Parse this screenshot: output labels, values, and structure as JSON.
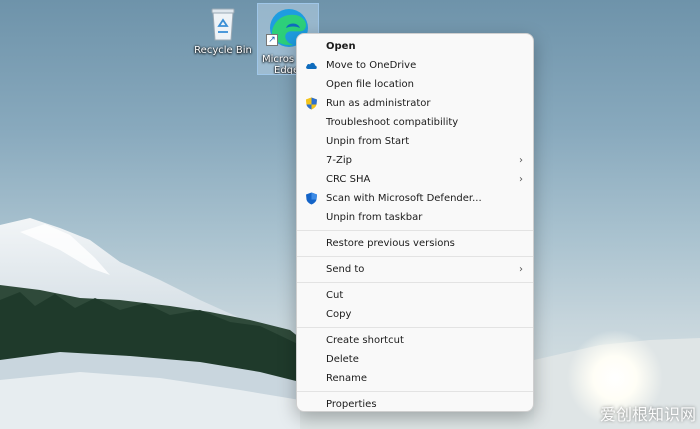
{
  "desktop": {
    "icons": [
      {
        "label": "Recycle Bin"
      },
      {
        "label_line1": "Micros",
        "label_line2": "Edge"
      }
    ]
  },
  "context_menu": {
    "items": [
      {
        "label": "Open",
        "icon": "none"
      },
      {
        "label": "Move to OneDrive",
        "icon": "onedrive-cloud-icon"
      },
      {
        "label": "Open file location",
        "icon": "none"
      },
      {
        "label": "Run as administrator",
        "icon": "uac-shield-icon"
      },
      {
        "label": "Troubleshoot compatibility",
        "icon": "none"
      },
      {
        "label": "Unpin from Start",
        "icon": "none"
      },
      {
        "label": "7-Zip",
        "icon": "none",
        "submenu": true
      },
      {
        "label": "CRC SHA",
        "icon": "none",
        "submenu": true
      },
      {
        "label": "Scan with Microsoft Defender...",
        "icon": "defender-shield-icon"
      },
      {
        "label": "Unpin from taskbar",
        "icon": "none"
      },
      {
        "label": "Restore previous versions",
        "icon": "none"
      },
      {
        "label": "Send to",
        "icon": "none",
        "submenu": true
      },
      {
        "label": "Cut",
        "icon": "none"
      },
      {
        "label": "Copy",
        "icon": "none"
      },
      {
        "label": "Create shortcut",
        "icon": "none"
      },
      {
        "label": "Delete",
        "icon": "none"
      },
      {
        "label": "Rename",
        "icon": "none"
      },
      {
        "label": "Properties",
        "icon": "none"
      }
    ],
    "chevron": "›"
  },
  "watermark": "爱创根知识网",
  "colors": {
    "onedrive": "#0f6cbd",
    "defender": "#1464c8",
    "menu_bg": "#f9f9f9"
  }
}
